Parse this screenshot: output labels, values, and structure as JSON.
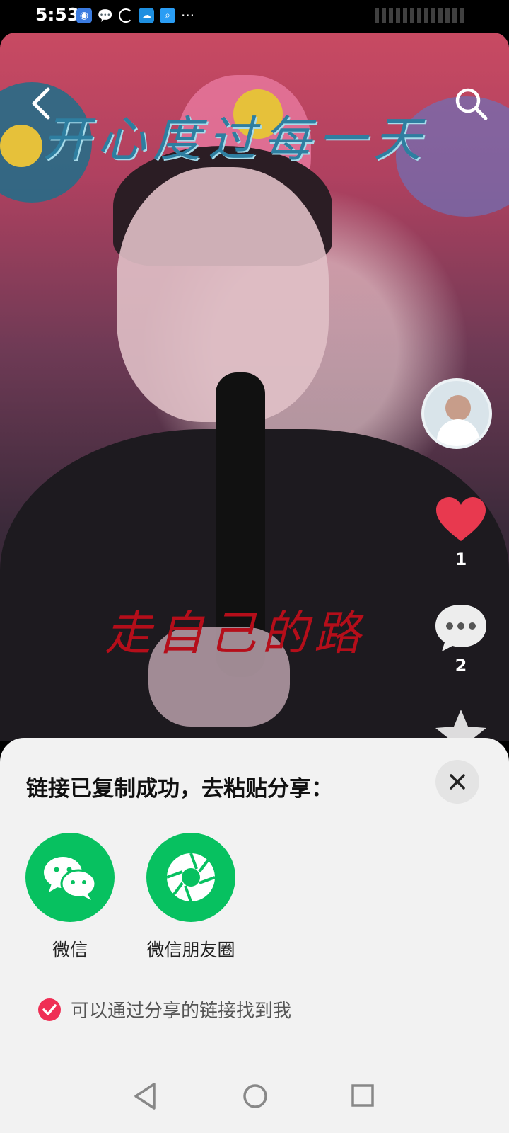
{
  "status_bar": {
    "time": "5:53",
    "more": "···"
  },
  "video": {
    "overlay_top_text": "开心度过每一天",
    "overlay_mid_text": "走自己的路"
  },
  "actions": {
    "like_count": "1",
    "comment_count": "2"
  },
  "share_sheet": {
    "title": "链接已复制成功，去粘贴分享：",
    "options": [
      {
        "label": "微信",
        "icon": "wechat-icon"
      },
      {
        "label": "微信朋友圈",
        "icon": "moments-icon"
      }
    ],
    "checkbox_label": "可以通过分享的链接找到我",
    "checkbox_checked": true
  },
  "colors": {
    "wechat_green": "#07c160",
    "check_red": "#ef2f55",
    "like_red": "#e8394f"
  }
}
